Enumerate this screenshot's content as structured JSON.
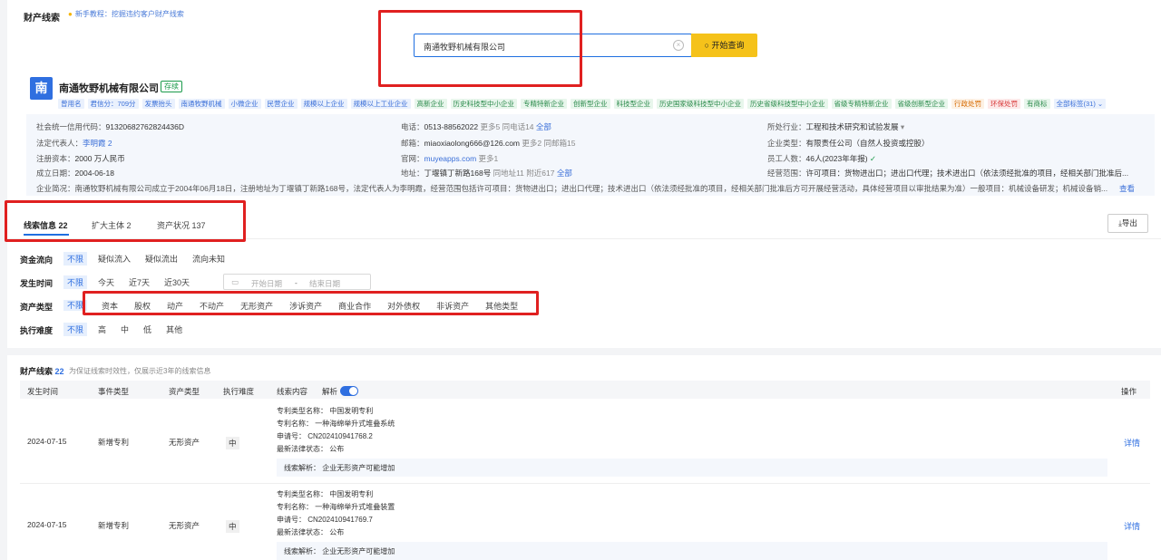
{
  "header": {
    "title": "财产线索",
    "hint": "新手教程：挖掘违约客户财产线索"
  },
  "search": {
    "value": "南通牧野机械有限公司",
    "button_label": "开始查询",
    "clear_icon": "×",
    "search_icon": "○"
  },
  "company": {
    "logo_char": "南",
    "name": "南通牧野机械有限公司",
    "status": "存续",
    "tags": [
      {
        "label": "曾用名",
        "style": "blue"
      },
      {
        "label": "君信分：709分",
        "style": "blue"
      },
      {
        "label": "发票抬头",
        "style": "blue"
      },
      {
        "label": "南通牧野机械",
        "style": "blue"
      },
      {
        "label": "小微企业",
        "style": "blue"
      },
      {
        "label": "民营企业",
        "style": "blue"
      },
      {
        "label": "规模以上企业",
        "style": "blue"
      },
      {
        "label": "规模以上工业企业",
        "style": "blue"
      },
      {
        "label": "高新企业",
        "style": "green"
      },
      {
        "label": "历史科技型中小企业",
        "style": "green"
      },
      {
        "label": "专精特新企业",
        "style": "green"
      },
      {
        "label": "创新型企业",
        "style": "green"
      },
      {
        "label": "科技型企业",
        "style": "green"
      },
      {
        "label": "历史国家级科技型中小企业",
        "style": "green"
      },
      {
        "label": "历史省级科技型中小企业",
        "style": "green"
      },
      {
        "label": "省级专精特新企业",
        "style": "green"
      },
      {
        "label": "省级创新型企业",
        "style": "green"
      },
      {
        "label": "行政处罚",
        "style": "orange"
      },
      {
        "label": "环保处罚",
        "style": "red"
      },
      {
        "label": "有商标",
        "style": "green"
      },
      {
        "label": "全部标签(31)",
        "style": "more"
      }
    ],
    "info": {
      "credit_code_label": "社会统一信用代码：",
      "credit_code": "91320682762824436D",
      "legal_rep_label": "法定代表人：",
      "legal_rep": "李明霞",
      "legal_rep_count": "2",
      "capital_label": "注册资本：",
      "capital": "2000 万人民币",
      "founded_label": "成立日期：",
      "founded": "2004-06-18",
      "phone_label": "电话：",
      "phone": "0513-88562022",
      "phone_more": "更多5",
      "phone_same": "同电话14",
      "phone_all": "全部",
      "email_label": "邮箱：",
      "email": "miaoxiaolong666@126.com",
      "email_more": "更多2",
      "email_same": "同邮箱15",
      "website_label": "官网：",
      "website": "muyeapps.com",
      "website_more": "更多1",
      "address_label": "地址：",
      "address": "丁堰镇丁新路168号",
      "address_same": "同地址11",
      "address_near": "附近617",
      "address_all": "全部",
      "industry_label": "所处行业：",
      "industry": "工程和技术研究和试验发展",
      "type_label": "企业类型：",
      "type": "有限责任公司（自然人投资或控股）",
      "staff_label": "员工人数：",
      "staff": "46人(2023年年报)",
      "scope_label": "经营范围：",
      "scope": "许可项目：货物进出口；进出口代理；技术进出口（依法须经批准的项目，经相关部门批准后...",
      "desc_label": "企业简况：",
      "desc": "南通牧野机械有限公司成立于2004年06月18日，注册地址为丁堰镇丁新路168号，法定代表人为李明霞，经营范围包括许可项目：货物进出口；进出口代理；技术进出口（依法须经批准的项目，经相关部门批准后方可开展经营活动，具体经营项目以审批结果为准）一般项目：机械设备研发；机械设备销...",
      "desc_more": "查看"
    }
  },
  "tabs": [
    {
      "label": "线索信息 22"
    },
    {
      "label": "扩大主体 2"
    },
    {
      "label": "资产状况 137"
    }
  ],
  "export_label": "导出",
  "filters": {
    "flow": {
      "label": "资金流向",
      "options": [
        "不限",
        "疑似流入",
        "疑似流出",
        "流向未知"
      ]
    },
    "time": {
      "label": "发生时间",
      "options": [
        "不限",
        "今天",
        "近7天",
        "近30天"
      ],
      "start_placeholder": "开始日期",
      "sep": "-",
      "end_placeholder": "结束日期"
    },
    "asset": {
      "label": "资产类型",
      "options": [
        "不限",
        "资本",
        "股权",
        "动产",
        "不动产",
        "无形资产",
        "涉诉资产",
        "商业合作",
        "对外债权",
        "非诉资产",
        "其他类型"
      ]
    },
    "difficulty": {
      "label": "执行难度",
      "options": [
        "不限",
        "高",
        "中",
        "低",
        "其他"
      ]
    }
  },
  "clues": {
    "title": "财产线索",
    "count": "22",
    "note": "为保证线索时效性，仅展示近3年的线索信息",
    "columns": [
      "发生时间",
      "事件类型",
      "资产类型",
      "执行难度",
      "线索内容",
      "解析",
      "操作"
    ],
    "rows": [
      {
        "date": "2024-07-15",
        "event": "新增专利",
        "asset": "无形资产",
        "difficulty": "中",
        "lines": [
          "专利类型名称：  中国发明专利",
          "专利名称：  一种海绵举升式堆叠系统",
          "申请号：  CN202410941768.2",
          "最新法律状态：  公布"
        ],
        "analysis": "线索解析：  企业无形资产可能增加",
        "action": "详情"
      },
      {
        "date": "2024-07-15",
        "event": "新增专利",
        "asset": "无形资产",
        "difficulty": "中",
        "lines": [
          "专利类型名称：  中国发明专利",
          "专利名称：  一种海绵举升式堆叠装置",
          "申请号：  CN202410941769.7",
          "最新法律状态：  公布"
        ],
        "analysis": "线索解析：  企业无形资产可能增加",
        "action": "详情"
      }
    ]
  }
}
